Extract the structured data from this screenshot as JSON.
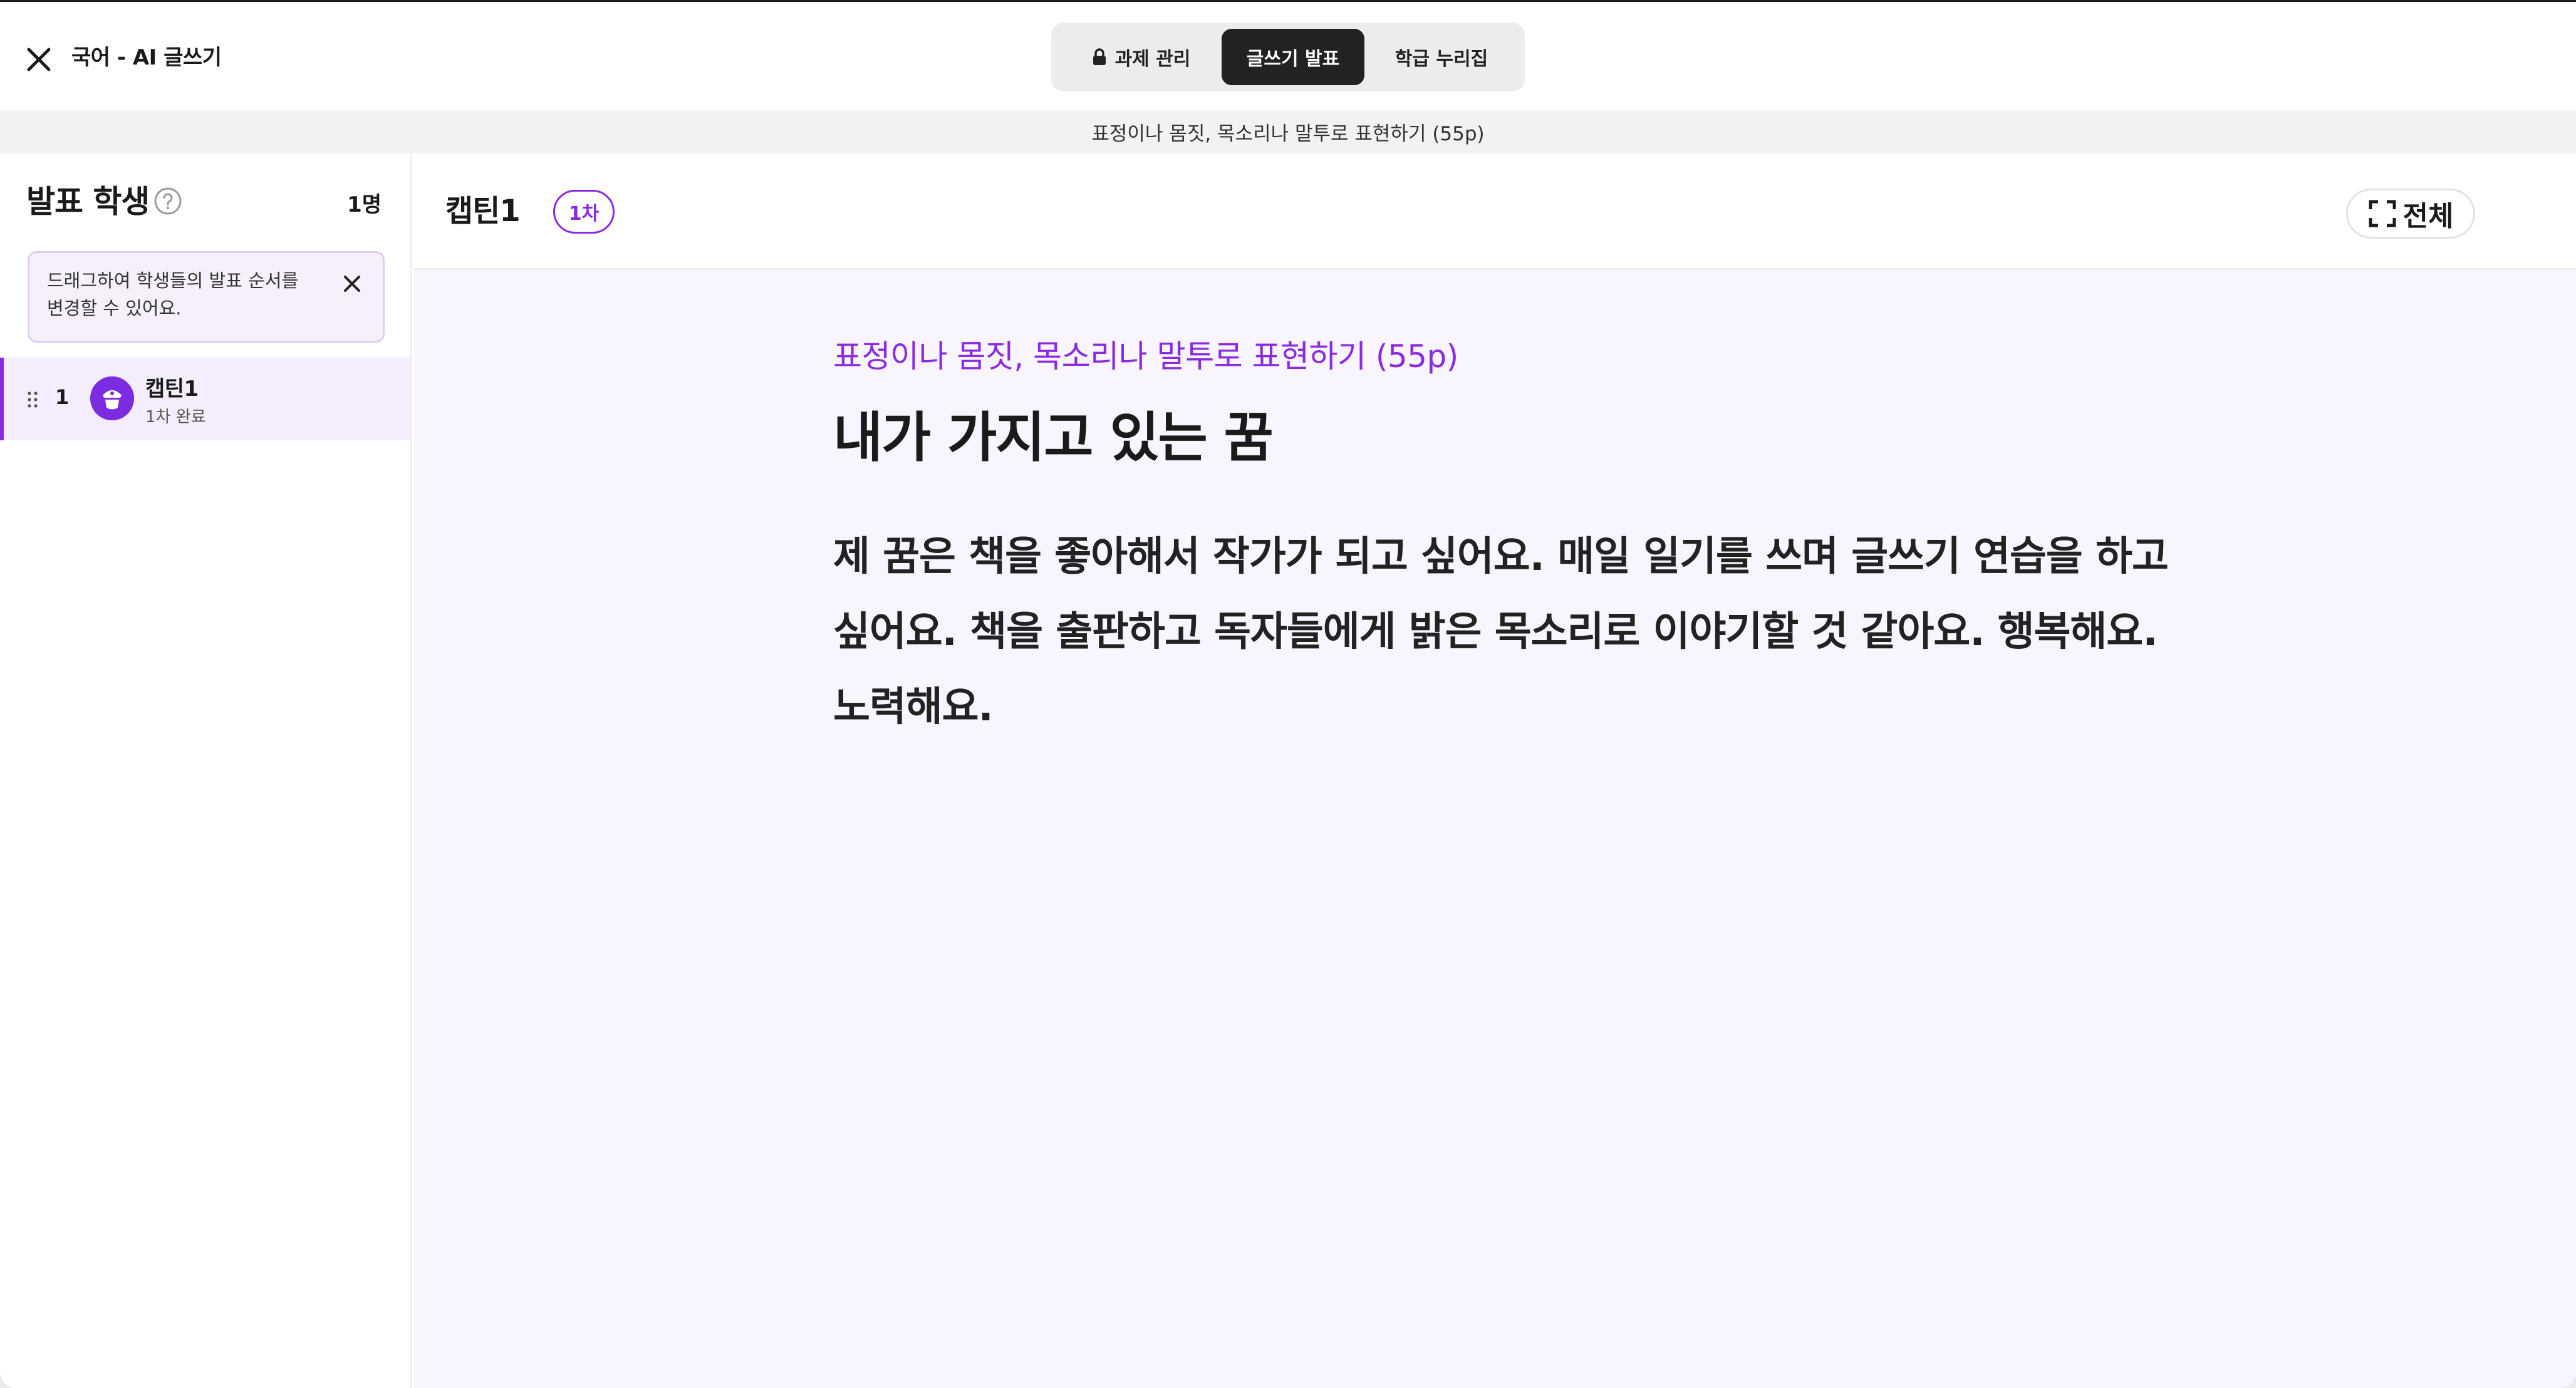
{
  "header": {
    "title": "국어 - AI 글쓰기",
    "tabs": [
      {
        "label": "과제 관리",
        "icon": "lock-icon"
      },
      {
        "label": "글쓰기 발표",
        "active": true
      },
      {
        "label": "학급 누리집"
      }
    ]
  },
  "subheader": {
    "text": "표정이나 몸짓, 목소리나 말투로 표현하기 (55p)"
  },
  "sidebar": {
    "title": "발표 학생",
    "count": "1명",
    "notice": "드래그하여 학생들의 발표 순서를 변경할 수 있어요.",
    "students": [
      {
        "number": "1",
        "name": "캡틴1",
        "status": "1차 완료",
        "avatar_color": "#7b2be0"
      }
    ]
  },
  "main": {
    "student_name": "캡틴1",
    "round": "1차",
    "fullscreen_label": "전체",
    "prompt": "표정이나 몸짓, 목소리나 말투로 표현하기 (55p)",
    "title": "내가 가지고 있는 꿈",
    "body": "제 꿈은 책을 좋아해서 작가가 되고 싶어요. 매일 일기를 쓰며 글쓰기 연습을 하고 싶어요. 책을 출판하고 독자들에게 밝은 목소리로 이야기할 것 같아요. 행복해요. 노력해요."
  },
  "colors": {
    "accent": "#8a2be2",
    "selected_row": "#f4edfd",
    "content_bg": "#f8f5fe",
    "active_tab": "#222222"
  }
}
